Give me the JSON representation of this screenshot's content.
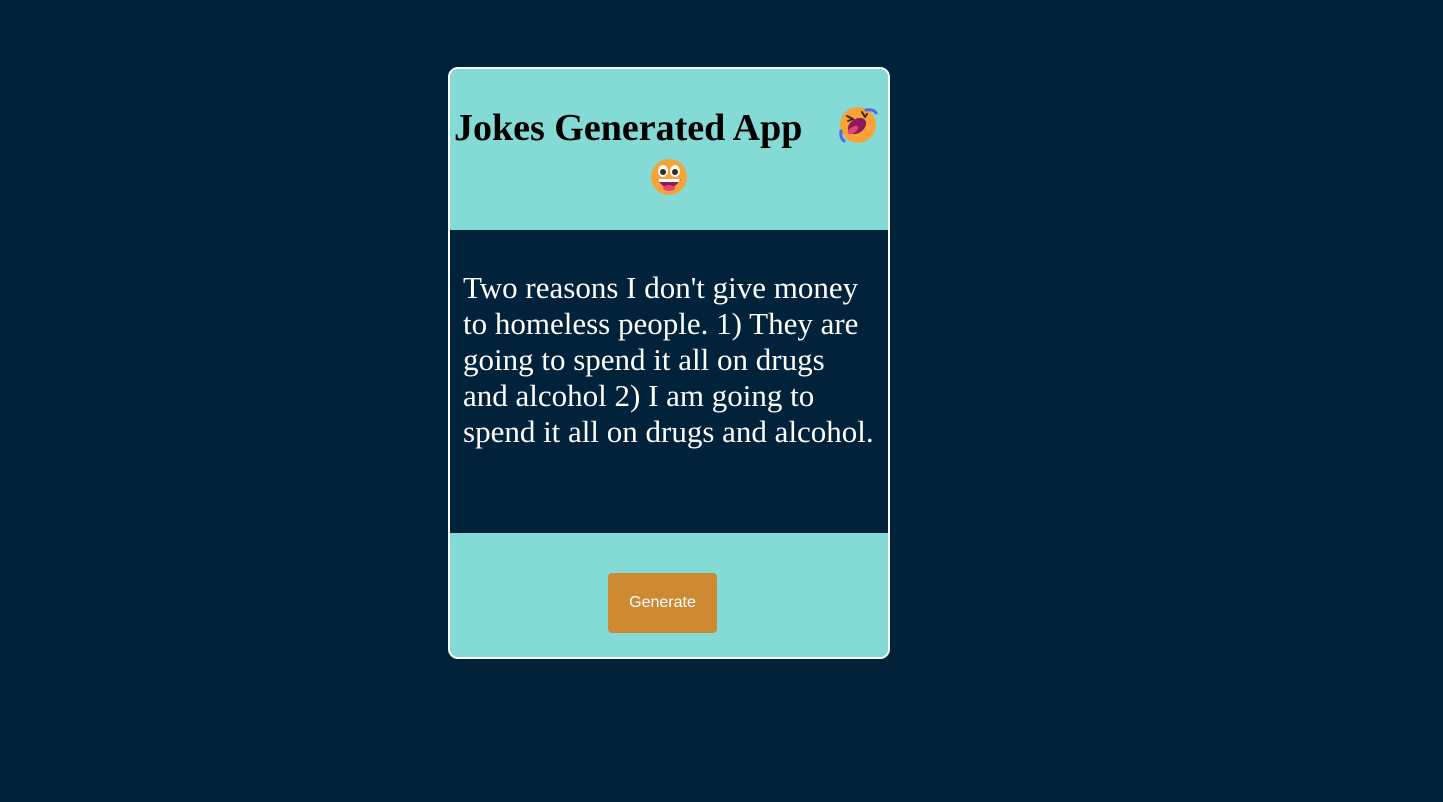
{
  "app": {
    "title": "Jokes Generated App",
    "title_emojis": [
      "rolling-on-floor-laughing-emoji",
      "grinning-face-emoji"
    ]
  },
  "joke": {
    "text": "Two reasons I don't give money to homeless people. 1) They are going to spend it all on drugs and alcohol 2) I am going to spend it all on drugs and alcohol."
  },
  "actions": {
    "generate_label": "Generate"
  },
  "colors": {
    "page_background": "#00233a",
    "card_accent": "#84dbd5",
    "joke_background": "#00223a",
    "button": "#cd8a33",
    "text_light": "#ffffff"
  }
}
